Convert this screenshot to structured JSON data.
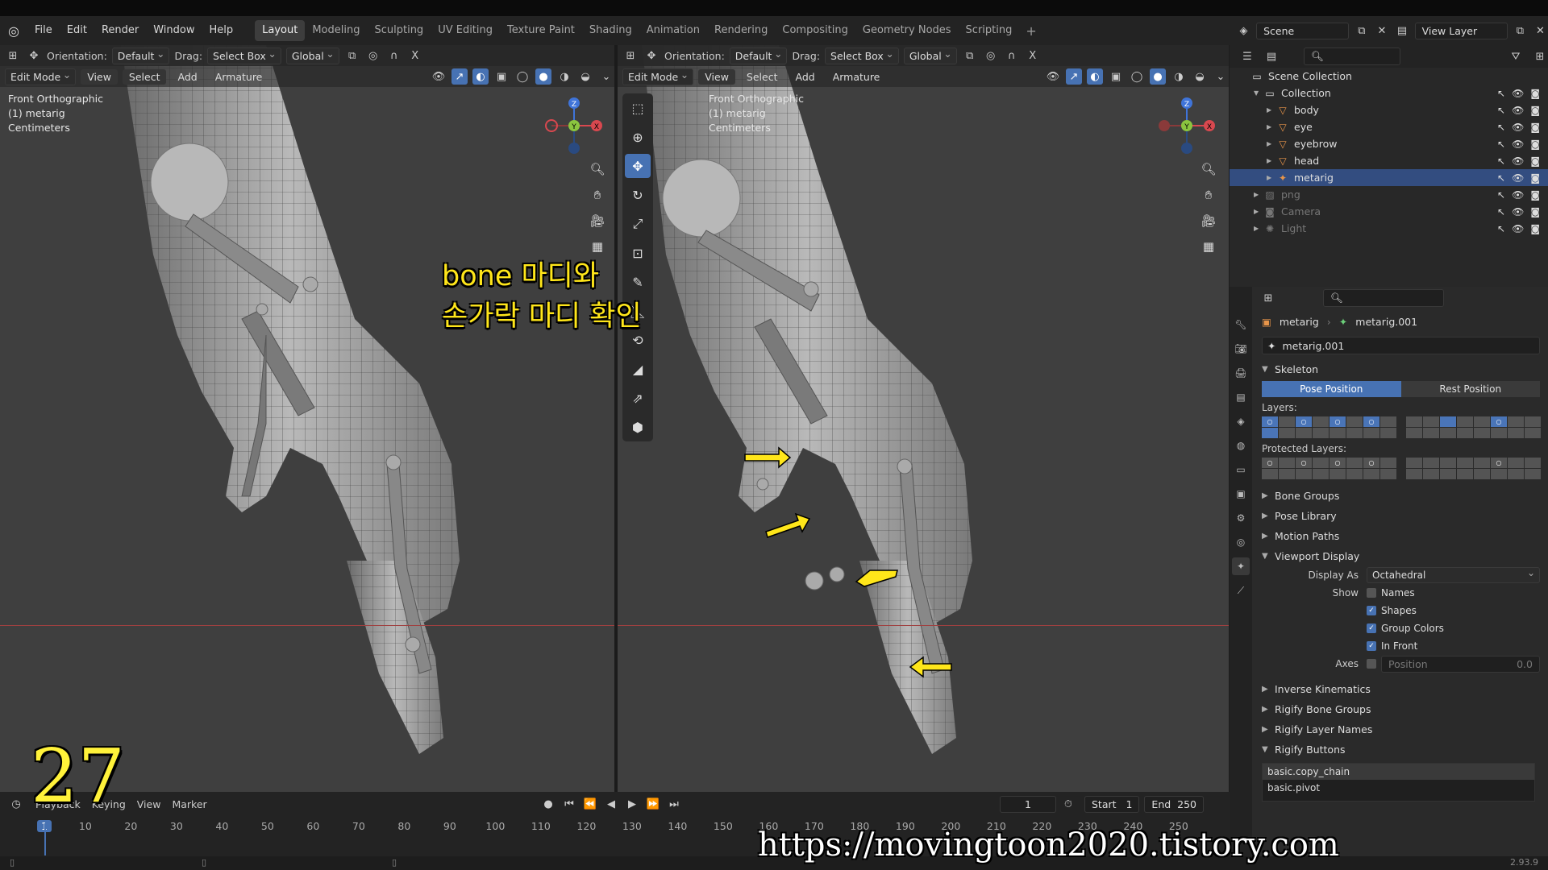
{
  "menubar": {
    "items": [
      "File",
      "Edit",
      "Render",
      "Window",
      "Help"
    ],
    "workspaces": [
      "Layout",
      "Modeling",
      "Sculpting",
      "UV Editing",
      "Texture Paint",
      "Shading",
      "Animation",
      "Rendering",
      "Compositing",
      "Geometry Nodes",
      "Scripting"
    ],
    "active_workspace": "Layout"
  },
  "viewport_header": {
    "orientation_label": "Orientation:",
    "orientation_value": "Default",
    "drag_label": "Drag:",
    "drag_value": "Select Box",
    "transform_value": "Global",
    "mode": "Edit Mode",
    "menus": [
      "View",
      "Select",
      "Add",
      "Armature"
    ]
  },
  "viewport_overlay": {
    "view_name": "Front Orthographic",
    "object": "(1) metarig",
    "units": "Centimeters"
  },
  "gizmo_axes": {
    "z": "Z",
    "y": "Y",
    "x": "X"
  },
  "annotation": {
    "line1": "bone 마디와",
    "line2": "손가락 마디 확인",
    "step_number": "27",
    "url": "https://movingtoon2020.tistory.com",
    "color": "#ffe61a"
  },
  "timeline": {
    "menus": [
      "Playback",
      "Keying",
      "View",
      "Marker"
    ],
    "current_frame": "1",
    "start_label": "Start",
    "start": "1",
    "end_label": "End",
    "end": "250",
    "ticks": [
      "1",
      "10",
      "20",
      "30",
      "40",
      "50",
      "60",
      "70",
      "80",
      "90",
      "100",
      "110",
      "120",
      "130",
      "140",
      "150",
      "160",
      "170",
      "180",
      "190",
      "200",
      "210",
      "220",
      "230",
      "240",
      "250"
    ]
  },
  "topbar_right": {
    "scene": "Scene",
    "view_layer": "View Layer"
  },
  "outliner": {
    "rows": [
      {
        "label": "Scene Collection",
        "indent": 0,
        "icon": "collection-icon"
      },
      {
        "label": "Collection",
        "indent": 1,
        "icon": "collection-icon"
      },
      {
        "label": "body",
        "indent": 2,
        "icon": "mesh-icon"
      },
      {
        "label": "eye",
        "indent": 2,
        "icon": "mesh-icon"
      },
      {
        "label": "eyebrow",
        "indent": 2,
        "icon": "mesh-icon"
      },
      {
        "label": "head",
        "indent": 2,
        "icon": "mesh-icon"
      },
      {
        "label": "metarig",
        "indent": 2,
        "icon": "armature-icon",
        "selected": true
      },
      {
        "label": "png",
        "indent": 1,
        "icon": "image-icon",
        "dim": true
      },
      {
        "label": "Camera",
        "indent": 1,
        "icon": "camera-icon",
        "dim": true
      },
      {
        "label": "Light",
        "indent": 1,
        "icon": "light-icon",
        "dim": true
      }
    ]
  },
  "properties": {
    "breadcrumb_object": "metarig",
    "breadcrumb_data": "metarig.001",
    "datablock": "metarig.001",
    "skeleton": "Skeleton",
    "pose_position": "Pose Position",
    "rest_position": "Rest Position",
    "layers_label": "Layers:",
    "protected_layers_label": "Protected Layers:",
    "sections_collapsed": [
      "Bone Groups",
      "Pose Library",
      "Motion Paths"
    ],
    "viewport_display": "Viewport Display",
    "display_as_label": "Display As",
    "display_as_value": "Octahedral",
    "show_label": "Show",
    "show_names": "Names",
    "show_shapes": "Shapes",
    "show_group_colors": "Group Colors",
    "show_in_front": "In Front",
    "axes_label": "Axes",
    "axes_position": "Position",
    "axes_value": "0.0",
    "sections_after": [
      "Inverse Kinematics",
      "Rigify Bone Groups",
      "Rigify Layer Names"
    ],
    "rigify_buttons": "Rigify Buttons",
    "rigify_list": [
      "basic.copy_chain",
      "basic.pivot"
    ]
  },
  "status": {
    "version": "2.93.9"
  },
  "colors": {
    "accent": "#4772b3",
    "viewport_bg": "#3f3f3f",
    "arrow": "#ffe61a"
  }
}
